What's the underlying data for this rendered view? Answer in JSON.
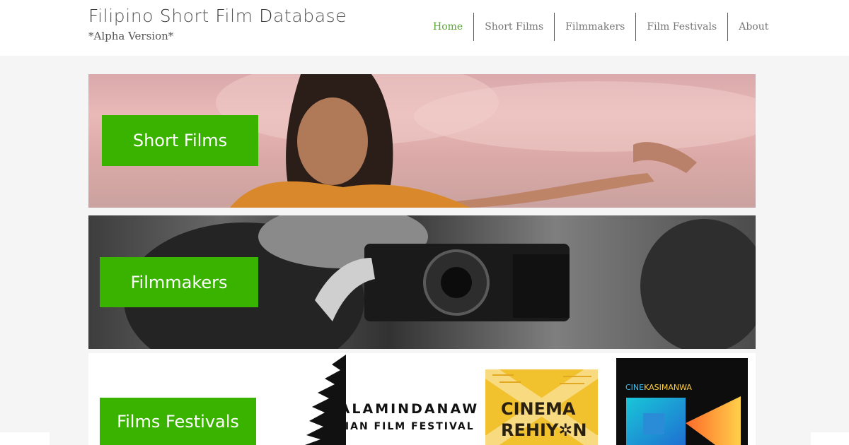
{
  "header": {
    "title_parts": [
      "F",
      "ilipino ",
      "S",
      "hort ",
      "F",
      "ilm ",
      "D",
      "atabase"
    ],
    "subtitle": "*Alpha Version*"
  },
  "nav": {
    "items": [
      "Home",
      "Short Films",
      "Filmmakers",
      "Film Festivals",
      "About"
    ],
    "active": "Home",
    "active_color": "#5aa532"
  },
  "sections": [
    {
      "label": "Short Films"
    },
    {
      "label": "Filmmakers"
    },
    {
      "label": "Films Festivals"
    }
  ],
  "festival_logos": {
    "salamindanaw_line1": "SALAMINDANAW",
    "salamindanaw_line2": "ASIAN FILM FESTIVAL",
    "cinema_line1": "CINEMA",
    "cinema_line2": "REHIY✲N",
    "cinekas_part1": "CINE",
    "cinekas_part2": "KASIMANWA"
  },
  "colors": {
    "cta_green": "#3ab300",
    "header_bg": "#ffffff",
    "page_bg": "#f5f5f5"
  }
}
